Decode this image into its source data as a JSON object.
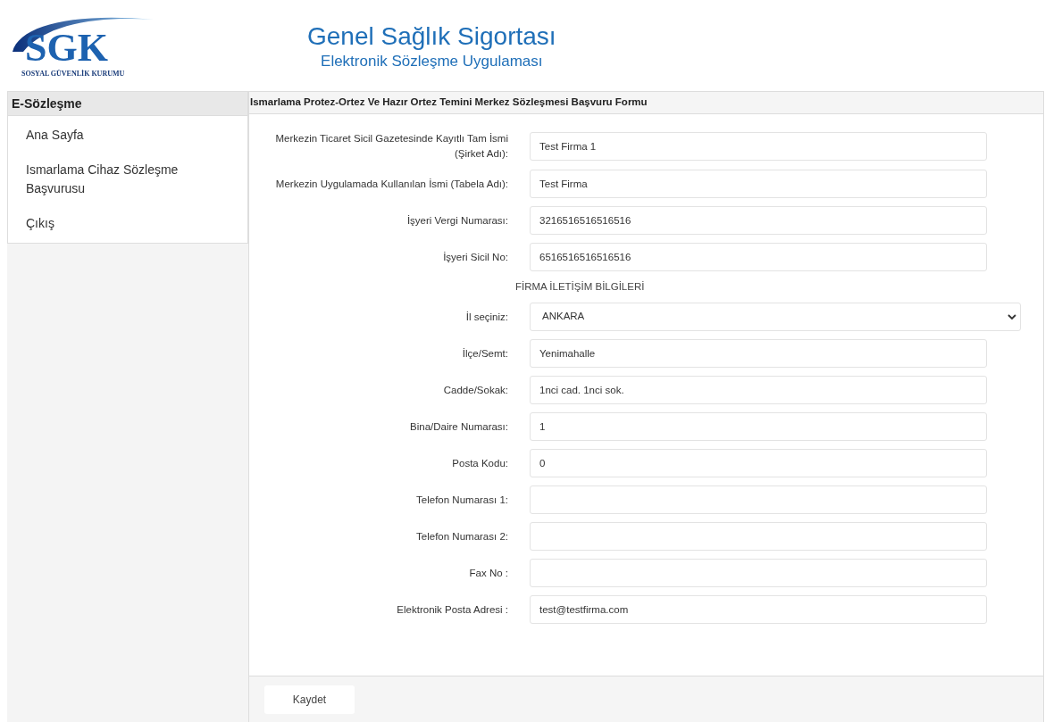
{
  "logo": {
    "letters": "SGK",
    "caption": "SOSYAL GÜVENLİK KURUMU"
  },
  "header": {
    "title": "Genel Sağlık Sigortası",
    "subtitle": "Elektronik Sözleşme Uygulaması"
  },
  "sidebar": {
    "title": "E-Sözleşme",
    "items": [
      "Ana Sayfa",
      "Ismarlama Cihaz Sözleşme Başvurusu",
      "Çıkış"
    ]
  },
  "form": {
    "title": "Ismarlama Protez-Ortez Ve Hazır Ortez Temini Merkez Sözleşmesi Başvuru Formu",
    "rows": [
      {
        "kind": "text",
        "label": "Merkezin Ticaret Sicil Gazetesinde Kayıtlı Tam İsmi (Şirket Adı):",
        "value": "Test Firma 1"
      },
      {
        "kind": "text",
        "label": "Merkezin Uygulamada Kullanılan İsmi (Tabela Adı):",
        "value": "Test Firma"
      },
      {
        "kind": "text",
        "label": "İşyeri Vergi Numarası:",
        "value": "3216516516516516"
      },
      {
        "kind": "text",
        "label": "İşyeri Sicil No:",
        "value": "6516516516516516"
      },
      {
        "kind": "heading",
        "label": "FİRMA İLETİŞİM BİLGİLERİ"
      },
      {
        "kind": "select",
        "label": "İl seçiniz:",
        "value": "ANKARA"
      },
      {
        "kind": "text",
        "label": "İlçe/Semt:",
        "value": "Yenimahalle"
      },
      {
        "kind": "text",
        "label": "Cadde/Sokak:",
        "value": "1nci cad. 1nci sok."
      },
      {
        "kind": "text",
        "label": "Bina/Daire Numarası:",
        "value": "1"
      },
      {
        "kind": "text",
        "label": "Posta Kodu:",
        "value": "0"
      },
      {
        "kind": "text",
        "label": "Telefon Numarası 1:"
      },
      {
        "kind": "text",
        "label": "Telefon Numarası 2:"
      },
      {
        "kind": "text",
        "label": "Fax No :"
      },
      {
        "kind": "text",
        "label": "Elektronik Posta Adresi :",
        "value": "test@testfirma.com"
      }
    ],
    "save_button": "Kaydet"
  }
}
